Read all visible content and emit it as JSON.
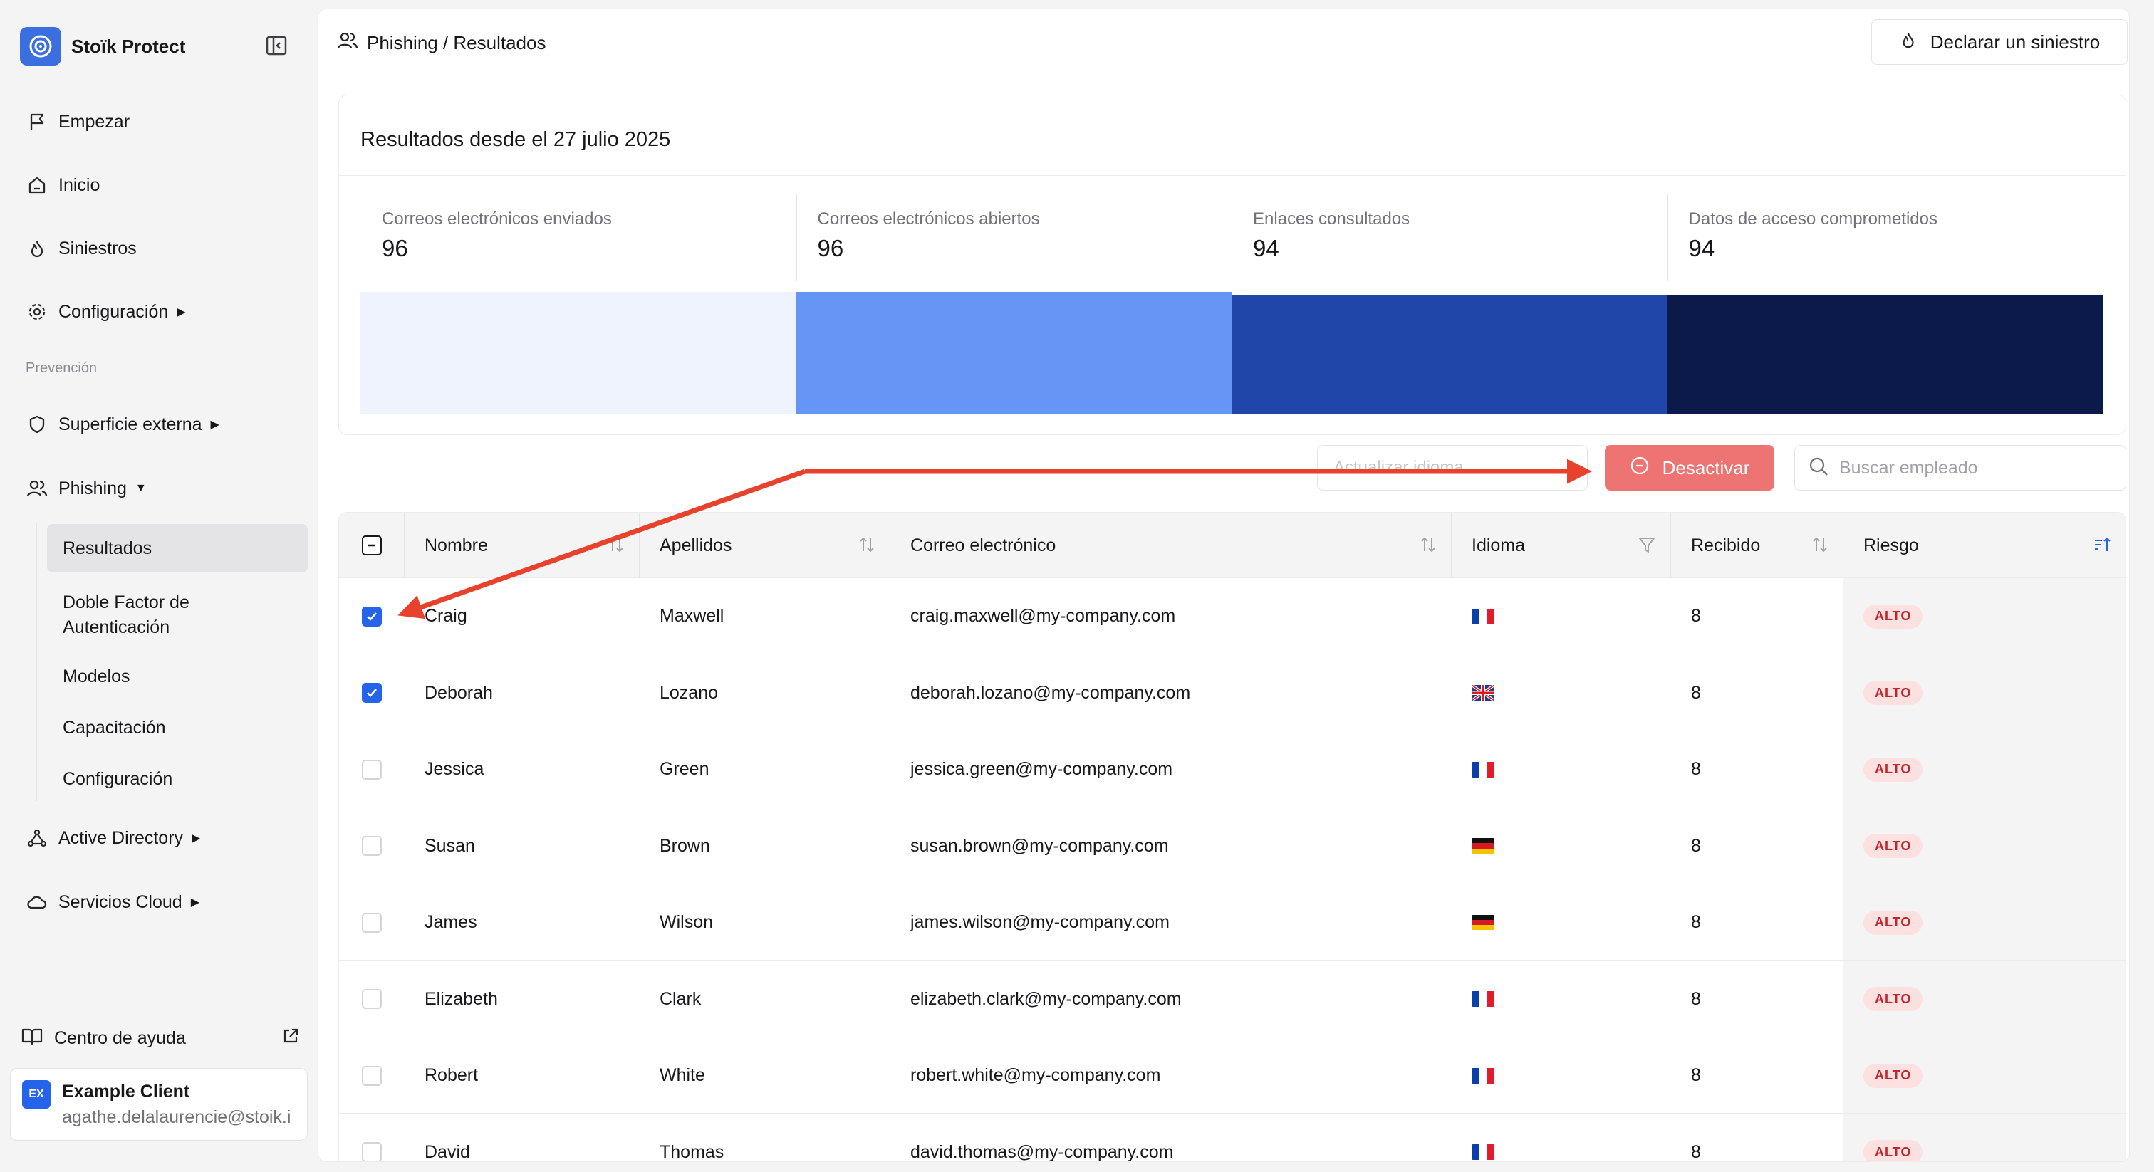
{
  "brand": {
    "name": "Stoïk Protect"
  },
  "nav": {
    "items": [
      {
        "label": "Empezar",
        "icon": "flag-icon"
      },
      {
        "label": "Inicio",
        "icon": "home-icon"
      },
      {
        "label": "Siniestros",
        "icon": "flame-icon"
      },
      {
        "label": "Configuración",
        "icon": "gear-icon"
      }
    ],
    "section_label": "Prevención",
    "prevention": [
      {
        "label": "Superficie externa",
        "icon": "shield-icon"
      },
      {
        "label": "Phishing",
        "icon": "users-icon"
      }
    ],
    "phishing_sub": [
      {
        "label": "Resultados"
      },
      {
        "label": "Doble Factor de Autenticación"
      },
      {
        "label": "Modelos"
      },
      {
        "label": "Capacitación"
      },
      {
        "label": "Configuración"
      }
    ],
    "bottom": [
      {
        "label": "Active Directory",
        "icon": "network-icon"
      },
      {
        "label": "Servicios Cloud",
        "icon": "cloud-icon"
      }
    ],
    "help": "Centro de ayuda"
  },
  "account": {
    "initials": "EX",
    "name": "Example Client",
    "email": "agathe.delalaurencie@stoik.i"
  },
  "header": {
    "breadcrumb": "Phishing / Resultados",
    "declare_button": "Declarar un siniestro"
  },
  "results": {
    "title": "Resultados desde el 27 julio 2025",
    "stages": [
      {
        "label": "Correos electrónicos enviados",
        "value": "96",
        "count": 96,
        "color": "#eef3fd"
      },
      {
        "label": "Correos electrónicos abiertos",
        "value": "96",
        "count": 96,
        "color": "#6595f5"
      },
      {
        "label": "Enlaces consultados",
        "value": "94",
        "count": 94,
        "color": "#1f46a8"
      },
      {
        "label": "Datos de acceso comprometidos",
        "value": "94",
        "count": 94,
        "color": "#0b1a4a"
      }
    ]
  },
  "toolbar": {
    "language_placeholder": "Actualizar idioma",
    "deactivate_label": "Desactivar",
    "search_placeholder": "Buscar empleado"
  },
  "table": {
    "columns": {
      "nombre": "Nombre",
      "apellidos": "Apellidos",
      "correo": "Correo electrónico",
      "idioma": "Idioma",
      "recibido": "Recibido",
      "riesgo": "Riesgo"
    },
    "rows": [
      {
        "checked": true,
        "nombre": "Craig",
        "apellidos": "Maxwell",
        "correo": "craig.maxwell@my-company.com",
        "idioma": "fr",
        "recibido": "8",
        "riesgo": "ALTO"
      },
      {
        "checked": true,
        "nombre": "Deborah",
        "apellidos": "Lozano",
        "correo": "deborah.lozano@my-company.com",
        "idioma": "gb",
        "recibido": "8",
        "riesgo": "ALTO"
      },
      {
        "checked": false,
        "nombre": "Jessica",
        "apellidos": "Green",
        "correo": "jessica.green@my-company.com",
        "idioma": "fr",
        "recibido": "8",
        "riesgo": "ALTO"
      },
      {
        "checked": false,
        "nombre": "Susan",
        "apellidos": "Brown",
        "correo": "susan.brown@my-company.com",
        "idioma": "de",
        "recibido": "8",
        "riesgo": "ALTO"
      },
      {
        "checked": false,
        "nombre": "James",
        "apellidos": "Wilson",
        "correo": "james.wilson@my-company.com",
        "idioma": "de",
        "recibido": "8",
        "riesgo": "ALTO"
      },
      {
        "checked": false,
        "nombre": "Elizabeth",
        "apellidos": "Clark",
        "correo": "elizabeth.clark@my-company.com",
        "idioma": "fr",
        "recibido": "8",
        "riesgo": "ALTO"
      },
      {
        "checked": false,
        "nombre": "Robert",
        "apellidos": "White",
        "correo": "robert.white@my-company.com",
        "idioma": "fr",
        "recibido": "8",
        "riesgo": "ALTO"
      },
      {
        "checked": false,
        "nombre": "David",
        "apellidos": "Thomas",
        "correo": "david.thomas@my-company.com",
        "idioma": "fr",
        "recibido": "8",
        "riesgo": "ALTO"
      }
    ]
  },
  "colors": {
    "accent": "#2563eb",
    "danger_button": "#ee7474",
    "annotation_arrow": "#e8412c"
  }
}
